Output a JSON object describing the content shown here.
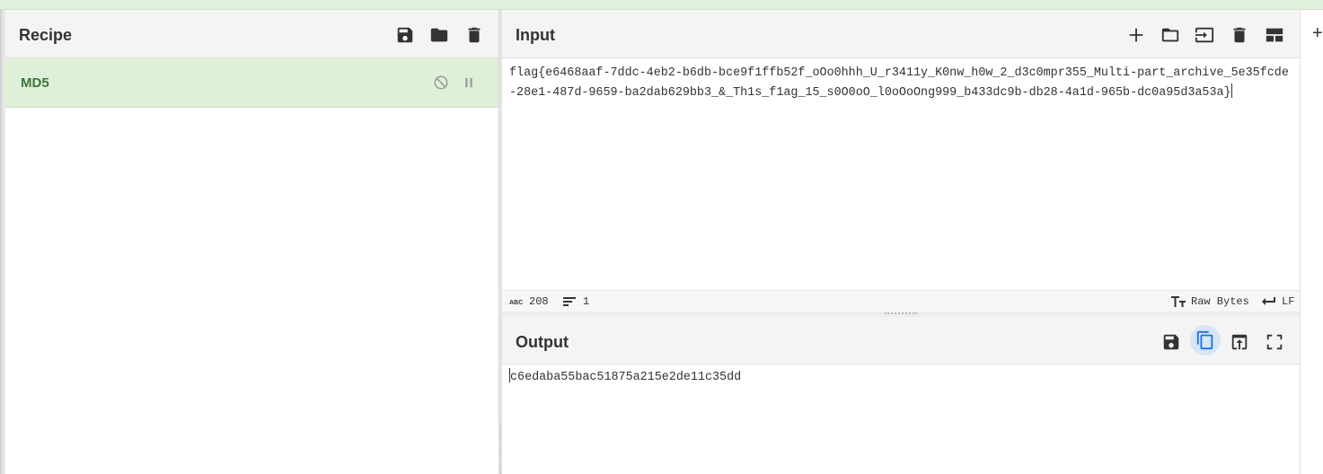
{
  "recipe": {
    "title": "Recipe",
    "operations": [
      {
        "name": "MD5"
      }
    ]
  },
  "input": {
    "title": "Input",
    "text": "flag{e6468aaf-7ddc-4eb2-b6db-bce9f1ffb52f_oOo0hhh_U_r3411y_K0nw_h0w_2_d3c0mpr355_Multi-part_archive_5e35fcde-28e1-487d-9659-ba2dab629bb3_&_Th1s_f1ag_15_s0O0oO_l0oOoOng999_b433dc9b-db28-4a1d-965b-dc0a95d3a53a}",
    "status": {
      "char_count": "208",
      "line_count": "1",
      "encoding": "Raw Bytes",
      "eol": "LF"
    }
  },
  "output": {
    "title": "Output",
    "text": "c6edaba55bac51875a215e2de11c35dd"
  },
  "icons": {
    "save": "save-icon",
    "open": "folder-icon",
    "clear": "trash-icon",
    "add": "plus-icon",
    "disable": "disable-icon",
    "pause": "pause-icon",
    "copy": "copy-icon",
    "replace_input": "replace-input-icon",
    "maximise": "maximise-icon",
    "reset_layout": "layout-icon",
    "insert_input": "insert-input-icon"
  },
  "colors": {
    "op_bg": "#dff0d8",
    "op_text": "#3c763d",
    "accent": "#1a73e8"
  }
}
